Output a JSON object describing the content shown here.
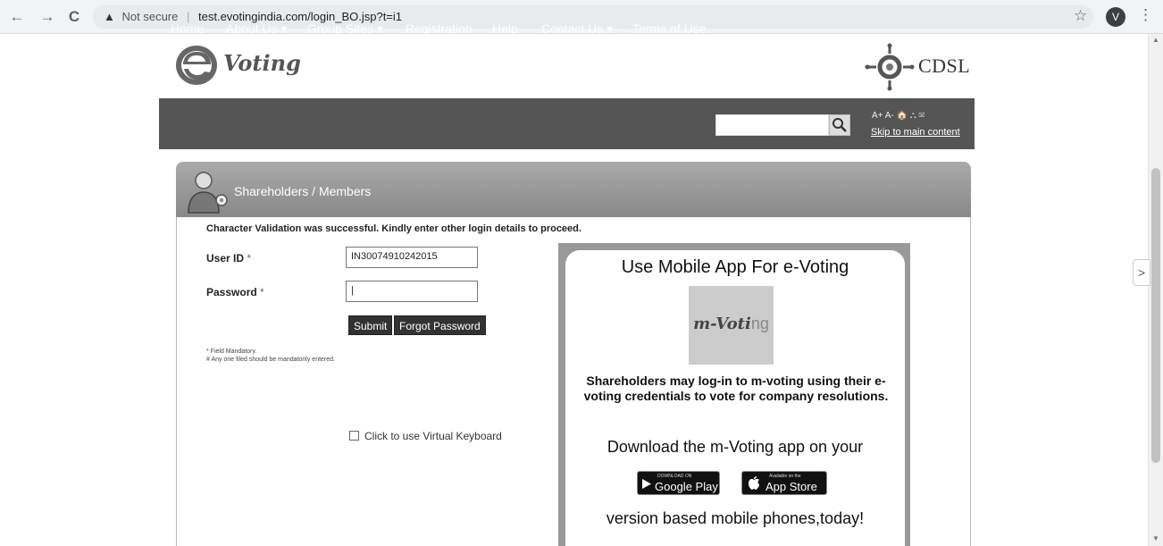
{
  "browser": {
    "back": "←",
    "forward": "→",
    "reload": "C",
    "warning_icon": "▲",
    "not_secure": "Not secure",
    "separator": "|",
    "url": "test.evotingindia.com/login_BO.jsp?t=i1",
    "bookmark_star": "☆",
    "profile_initial": "V",
    "menu": "⋮"
  },
  "header": {
    "logo_text": "Voting",
    "brand": "CDSL"
  },
  "nav": {
    "items": [
      "Home",
      "About Us ▾",
      "Group Sites ▾",
      "Registration",
      "Help",
      "Contact Us ▾",
      "Terms of Use"
    ],
    "search_placeholder": "",
    "tools": "A+  A-  🏠  ⛬  ✉",
    "skip_link": "Skip to main content"
  },
  "panel": {
    "title": "Shareholders / Members"
  },
  "form": {
    "message": "Character Validation was successful. Kindly enter other login details to proceed.",
    "user_id_label": "User ID",
    "password_label": "Password",
    "required_mark": "*",
    "user_id_value": "IN30074910242015",
    "password_value": "|",
    "submit_label": "Submit",
    "forgot_label": "Forgot Password",
    "note1": "* Field Mandatory.",
    "note2": "# Any one filed should be mandatorily entered.",
    "virtual_keyboard_label": "Click to use Virtual Keyboard"
  },
  "promo": {
    "title": "Use Mobile App For e-Voting",
    "logo_main": "m-Voti",
    "logo_tail": "ng",
    "description": "Shareholders may log-in to m-voting using their e-voting credentials to vote for company resolutions.",
    "download_text": "Download the m-Voting app on your",
    "google_small": "DOWNLOAD ON",
    "google_big": "Google Play",
    "apple_small": "Available on the",
    "apple_big": "App Store",
    "version_text": "version based mobile phones,today!"
  },
  "side_tab_arrow": ">",
  "scroll_up": "▲",
  "scroll_down": "▼"
}
